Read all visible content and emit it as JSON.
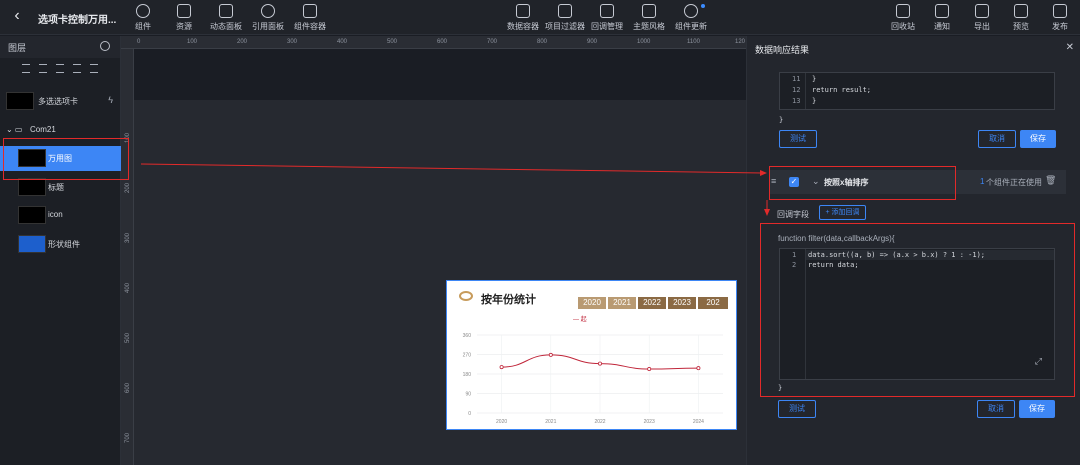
{
  "header": {
    "title": "选项卡控制万用...",
    "back": "chevron-left-icon",
    "tools_left": [
      "组件",
      "资源",
      "动态面板",
      "引用面板",
      "组件容器"
    ],
    "tools_center": [
      "数据容器",
      "项目过滤器",
      "回调管理",
      "主题风格",
      "组件更新"
    ],
    "tools_right": [
      "回收站",
      "通知",
      "导出",
      "预览",
      "发布"
    ]
  },
  "layers": {
    "title": "图层",
    "items": [
      {
        "label": "多选选项卡"
      },
      {
        "label": "Com21"
      },
      {
        "label": "万用图"
      },
      {
        "label": "标题"
      },
      {
        "label": "icon"
      },
      {
        "label": "形状组件"
      }
    ]
  },
  "ruler": {
    "h": [
      "0",
      "100",
      "200",
      "300",
      "400",
      "500",
      "600",
      "700",
      "800",
      "900",
      "1000",
      "1100",
      "120"
    ],
    "v": [
      "100",
      "200",
      "300",
      "400",
      "500",
      "600",
      "700"
    ]
  },
  "widget": {
    "title": "按年份统计",
    "years": [
      "2020",
      "2021",
      "2022",
      "2023",
      "202"
    ],
    "legend": "— 起"
  },
  "chart_data": {
    "type": "line",
    "categories": [
      "2020",
      "2021",
      "2022",
      "2023",
      "2024"
    ],
    "series": [
      {
        "values": [
          212,
          268,
          228,
          203,
          207
        ]
      }
    ],
    "yticks": [
      "360",
      "270",
      "180",
      "90",
      "0"
    ],
    "ylim": [
      0,
      360
    ],
    "color": "#c0263a",
    "grid": true
  },
  "panel": {
    "title": "数据响应结果",
    "close": "close-icon",
    "top_code": [
      {
        "n": "11",
        "t": "}"
      },
      {
        "n": "12",
        "t": "return result;"
      },
      {
        "n": "13",
        "t": "}"
      }
    ],
    "brace": "}",
    "test": "测试",
    "cancel": "取消",
    "save": "保存",
    "filter": {
      "name": "按照x轴排序",
      "usage_count": "1",
      "usage_text": "个组件正在使用"
    },
    "callback_label": "回调字段",
    "add_callback": "+ 添加回调",
    "fn_sig": "function filter(data,callbackArgs){",
    "code": [
      {
        "n": "1",
        "t": "data.sort((a, b) => (a.x > b.x) ? 1 : -1);"
      },
      {
        "n": "2",
        "t": "return data;"
      }
    ],
    "end_brace": "}"
  }
}
